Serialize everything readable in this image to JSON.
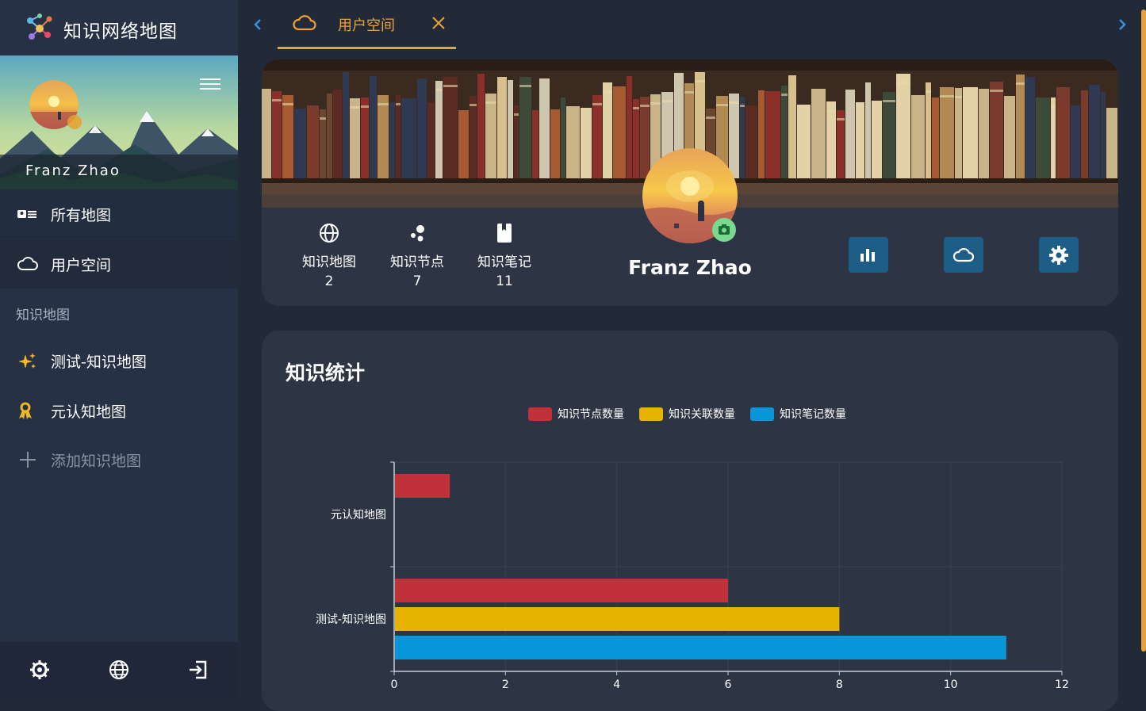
{
  "app": {
    "title": "知识网络地图"
  },
  "sidebar": {
    "username": "Franz Zhao",
    "nav": [
      {
        "label": "所有地图",
        "icon": "id-card-icon"
      },
      {
        "label": "用户空间",
        "icon": "cloud-icon"
      }
    ],
    "section_label": "知识地图",
    "maps": [
      {
        "label": "测试-知识地图",
        "icon": "sparkles-icon"
      },
      {
        "label": "元认知地图",
        "icon": "ribbon-icon"
      }
    ],
    "add_label": "添加知识地图",
    "footer_icons": [
      "settings-icon",
      "globe-icon",
      "logout-icon"
    ]
  },
  "tabs": [
    {
      "label": "用户空间",
      "icon": "cloud-icon",
      "active": true
    }
  ],
  "profile": {
    "name": "Franz Zhao",
    "stats": [
      {
        "label": "知识地图",
        "value": "2",
        "icon": "globe-icon"
      },
      {
        "label": "知识节点",
        "value": "7",
        "icon": "nodes-icon"
      },
      {
        "label": "知识笔记",
        "value": "11",
        "icon": "bookmark-icon"
      }
    ],
    "actions": [
      "bar-chart-icon",
      "cloud-icon",
      "gear-icon"
    ]
  },
  "stats_section": {
    "title": "知识统计"
  },
  "colors": {
    "accent": "#e9a23b",
    "button": "#1e5d86",
    "red": "#c1313a",
    "yellow": "#e6b400",
    "blue": "#0797d9"
  },
  "chart_data": {
    "type": "bar",
    "orientation": "horizontal",
    "categories": [
      "元认知地图",
      "测试-知识地图"
    ],
    "series": [
      {
        "name": "知识节点数量",
        "color": "#c1313a",
        "values": [
          1,
          6
        ]
      },
      {
        "name": "知识关联数量",
        "color": "#e6b400",
        "values": [
          0,
          8
        ]
      },
      {
        "name": "知识笔记数量",
        "color": "#0797d9",
        "values": [
          0,
          11
        ]
      }
    ],
    "xlim": [
      0,
      12
    ],
    "xticks": [
      "0",
      "2",
      "4",
      "6",
      "8",
      "10",
      "12"
    ],
    "grid": true,
    "legend": "top-center"
  }
}
